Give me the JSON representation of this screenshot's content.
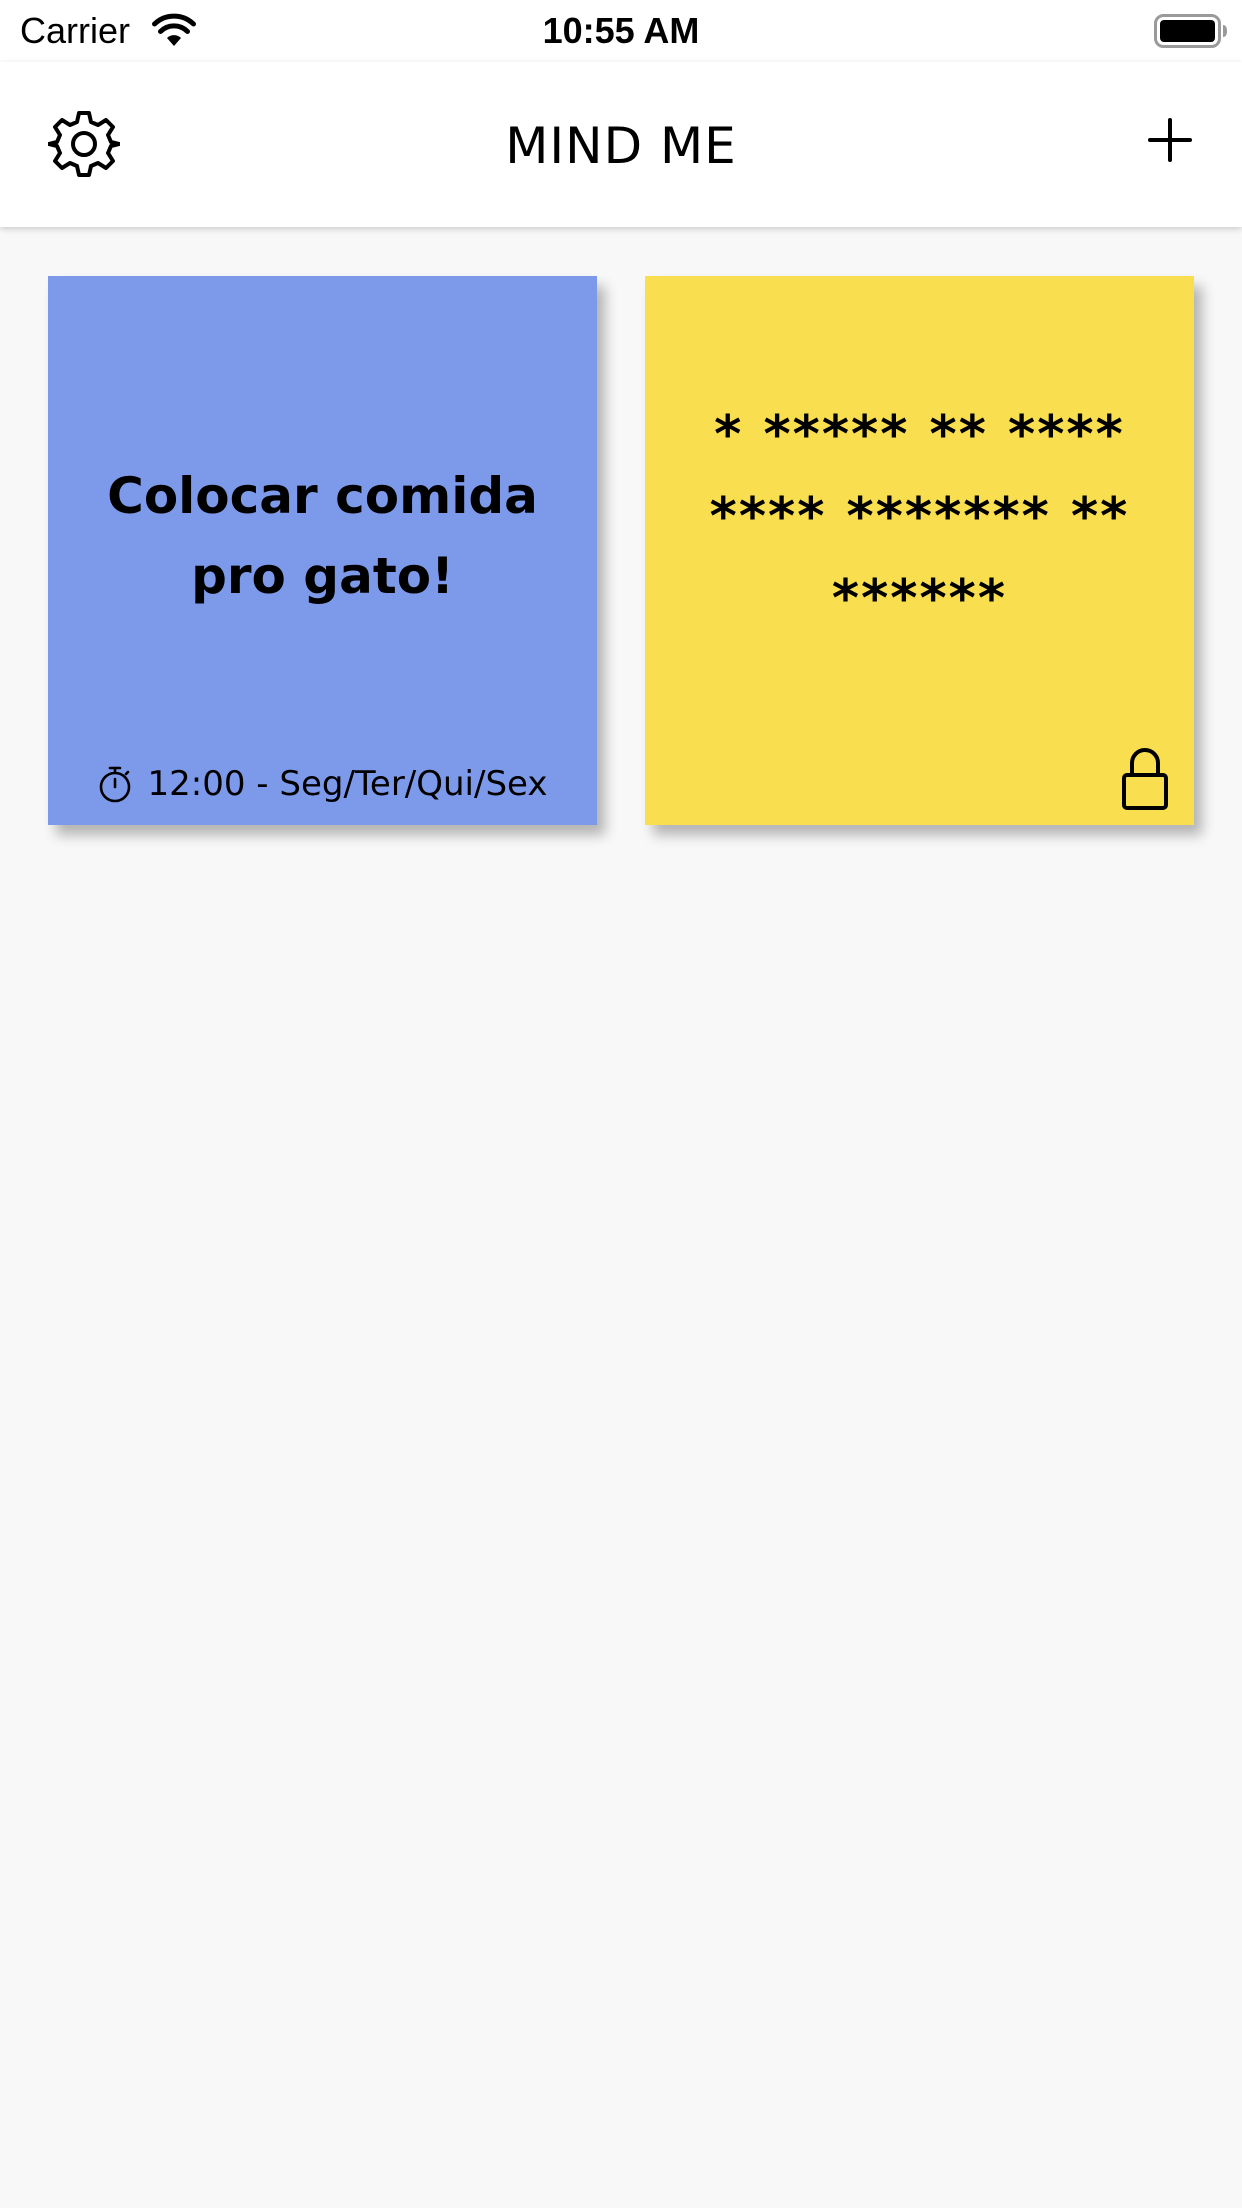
{
  "status_bar": {
    "carrier": "Carrier",
    "time": "10:55 AM"
  },
  "header": {
    "title": "MIND ME",
    "left_icon": "gear-icon",
    "right_icon": "plus-icon"
  },
  "notes": [
    {
      "text": "Colocar comida pro gato!",
      "color": "#7d9aea",
      "schedule": "12:00 - Seg/Ter/Qui/Sex",
      "schedule_icon": "stopwatch-icon",
      "locked": false
    },
    {
      "text": "* ***** ** **** **** ******* ** ******",
      "color": "#f9de4f",
      "locked": true,
      "lock_icon": "lock-icon"
    }
  ],
  "colors": {
    "background": "#f8f8f8",
    "bars": "#ffffff"
  }
}
